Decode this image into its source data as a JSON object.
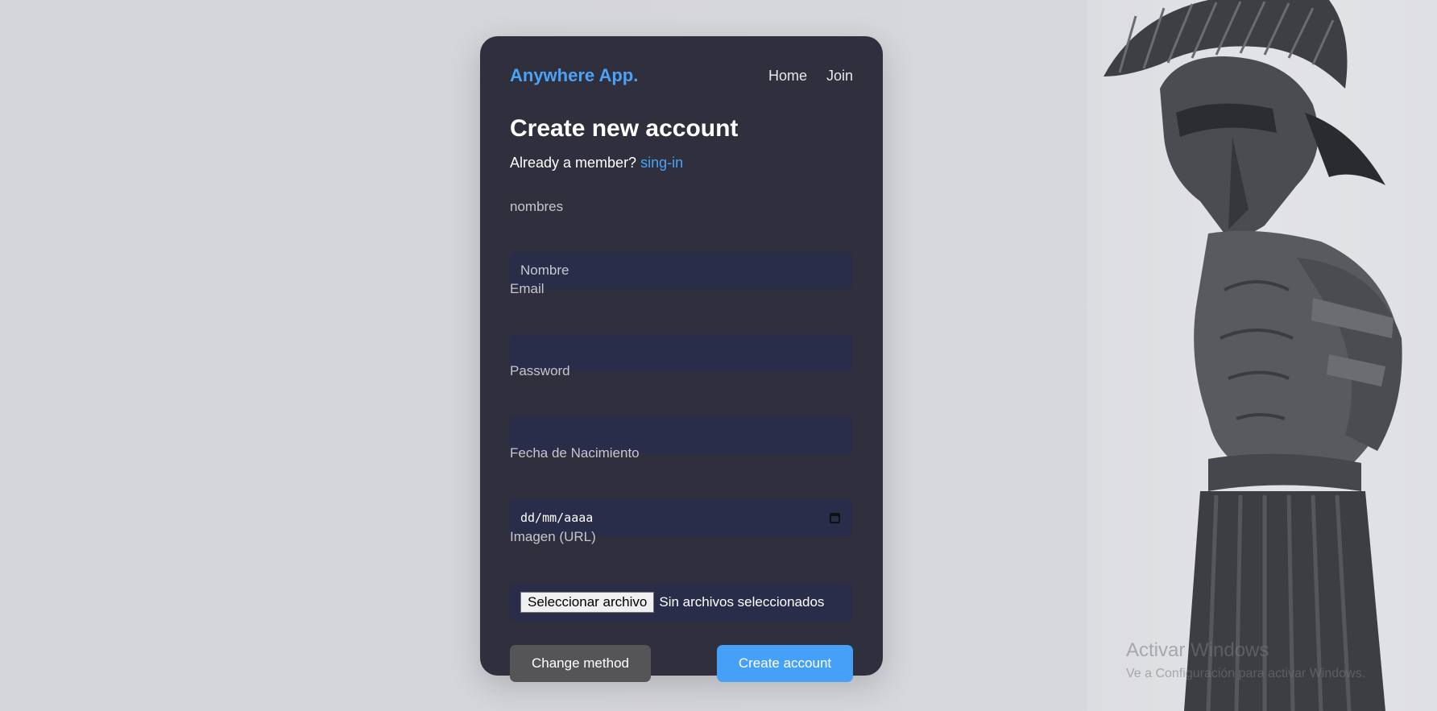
{
  "nav": {
    "brand": "Anywhere App.",
    "links": [
      "Home",
      "Join"
    ]
  },
  "form": {
    "title": "Create new account",
    "subtitle": "Already a member?",
    "signin_link": "sing-in",
    "fields": {
      "nombres": {
        "label": "nombres",
        "placeholder": "Nombre",
        "value": ""
      },
      "email": {
        "label": "Email",
        "value": ""
      },
      "password": {
        "label": "Password",
        "value": ""
      },
      "birthdate": {
        "label": "Fecha de Nacimiento",
        "value": "dd/mm/aaaa"
      },
      "image": {
        "label": "Imagen (URL)",
        "button": "Seleccionar archivo",
        "status": "Sin archivos seleccionados"
      }
    },
    "buttons": {
      "change_method": "Change method",
      "create_account": "Create account"
    }
  },
  "hero": {
    "icon": "spartan-warrior-illustration"
  },
  "watermark": {
    "title": "Activar Windows",
    "subtitle": "Ve a Configuración para activar Windows."
  },
  "colors": {
    "accent": "#4aa3f5",
    "card": "#302f3d",
    "field": "#2a2d49",
    "primary_button": "#46a0f8",
    "secondary_button": "#555558"
  }
}
